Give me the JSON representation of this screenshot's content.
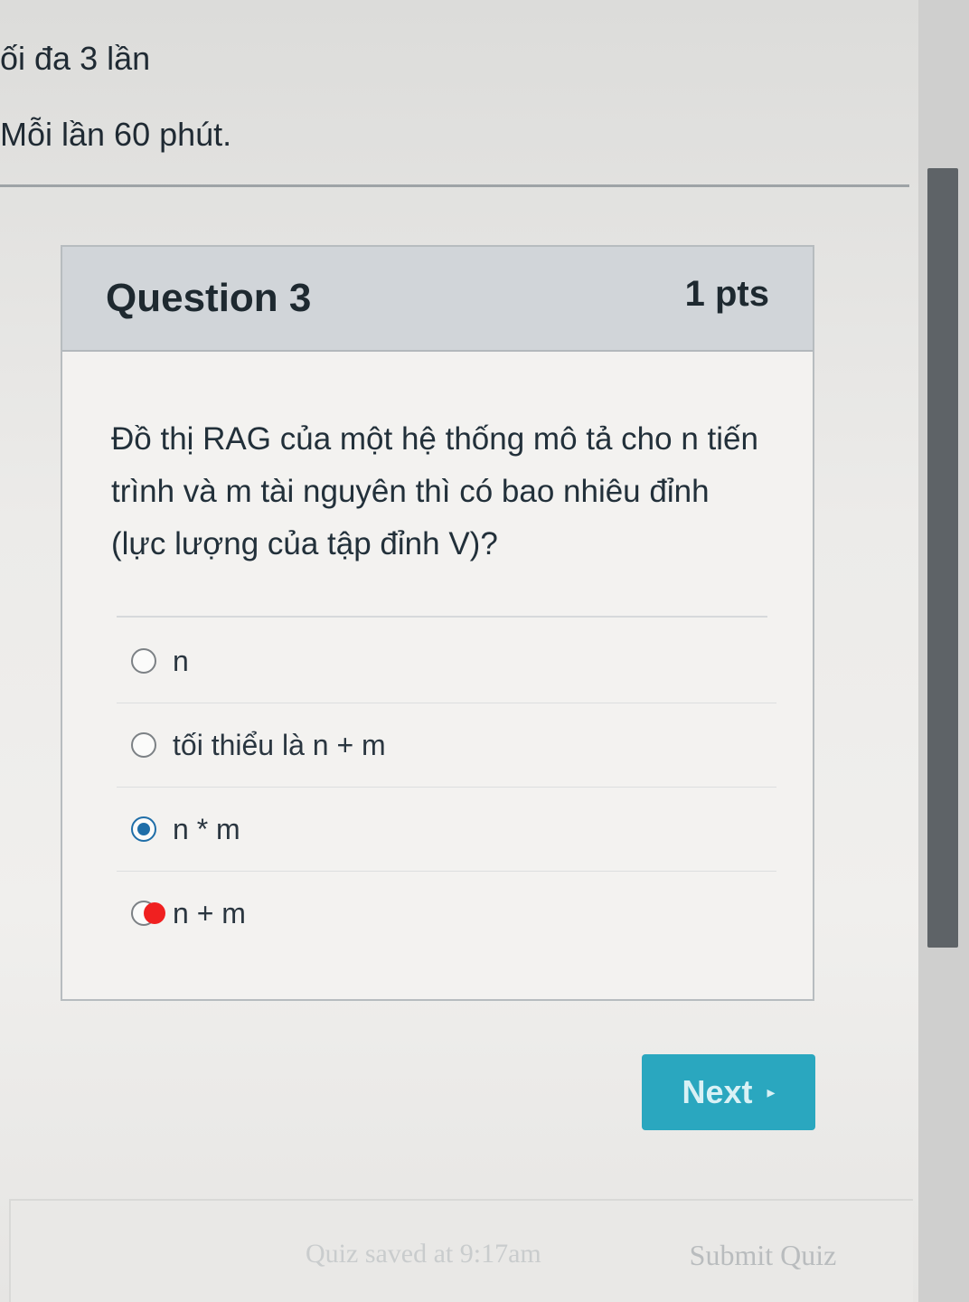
{
  "info": {
    "attempts": "ối đa 3 lần",
    "time_limit": "Mỗi lần 60 phút."
  },
  "question": {
    "title": "Question 3",
    "points": "1 pts",
    "text": "Đồ thị RAG của một hệ thống mô tả cho n tiến trình và m tài nguyên thì có bao nhiêu đỉnh (lực lượng của tập đỉnh V)?",
    "answers": [
      {
        "label": "n",
        "selected": false
      },
      {
        "label": "tối thiểu là n + m",
        "selected": false
      },
      {
        "label": "n * m",
        "selected": true
      },
      {
        "label": "n + m",
        "selected": false,
        "marked": true
      }
    ]
  },
  "nav": {
    "next_label": "Next",
    "next_arrow": "▸"
  },
  "footer": {
    "saved_status": "Quiz saved at 9:17am",
    "submit_label": "Submit Quiz"
  },
  "colors": {
    "accent": "#2aa7bf",
    "radio_selected": "#1f6ea8",
    "marker": "#f02020"
  }
}
